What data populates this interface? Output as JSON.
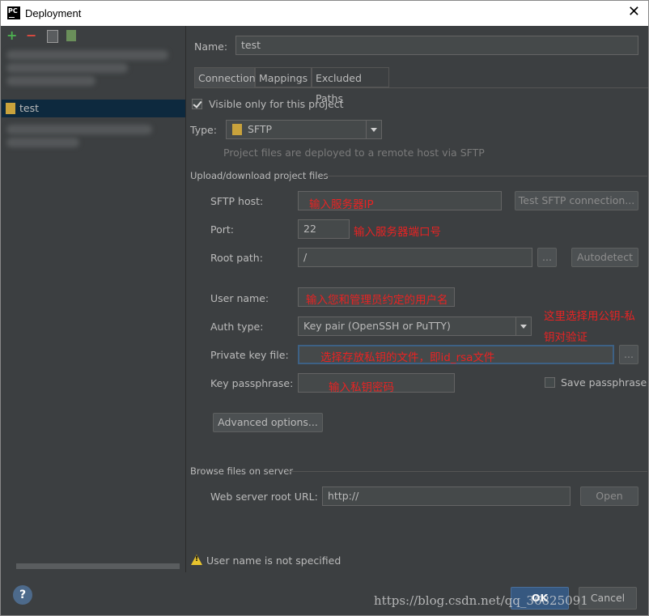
{
  "window": {
    "title": "Deployment",
    "app_icon": "PC"
  },
  "toolbar": {
    "add": "+",
    "remove": "−"
  },
  "server_list": {
    "selected": "test"
  },
  "form": {
    "name_label": "Name:",
    "name_value": "test",
    "tabs": [
      "Connection",
      "Mappings",
      "Excluded Paths"
    ],
    "visible_only": "Visible only for this project",
    "type_label": "Type:",
    "type_value": "SFTP",
    "type_hint": "Project files are deployed to a remote host via SFTP",
    "section_upload": "Upload/download project files",
    "sftp_host_label": "SFTP host:",
    "test_button": "Test SFTP connection...",
    "port_label": "Port:",
    "port_value": "22",
    "root_path_label": "Root path:",
    "root_path_value": "/",
    "browse_button": "...",
    "autodetect_button": "Autodetect",
    "user_name_label": "User name:",
    "auth_type_label": "Auth type:",
    "auth_type_value": "Key pair (OpenSSH or PuTTY)",
    "private_key_label": "Private key file:",
    "key_browse_button": "...",
    "passphrase_label": "Key passphrase:",
    "save_passphrase": "Save passphrase",
    "advanced_button": "Advanced options...",
    "section_browse": "Browse files on server",
    "web_root_label": "Web server root URL:",
    "web_root_value": "http://",
    "open_button": "Open",
    "warning": "User name is not specified"
  },
  "annotations": {
    "host": "输入服务器IP",
    "port": "输入服务器端口号",
    "user": "输入您和管理员约定的用户名",
    "auth_line1": "这里选择用公钥-私",
    "auth_line2": "钥对验证",
    "key": "选择存放私钥的文件，即id_rsa文件",
    "passphrase": "输入私钥密码"
  },
  "footer": {
    "help": "?",
    "ok": "OK",
    "cancel": "Cancel",
    "watermark": "https://blog.csdn.net/qq_36825091"
  }
}
